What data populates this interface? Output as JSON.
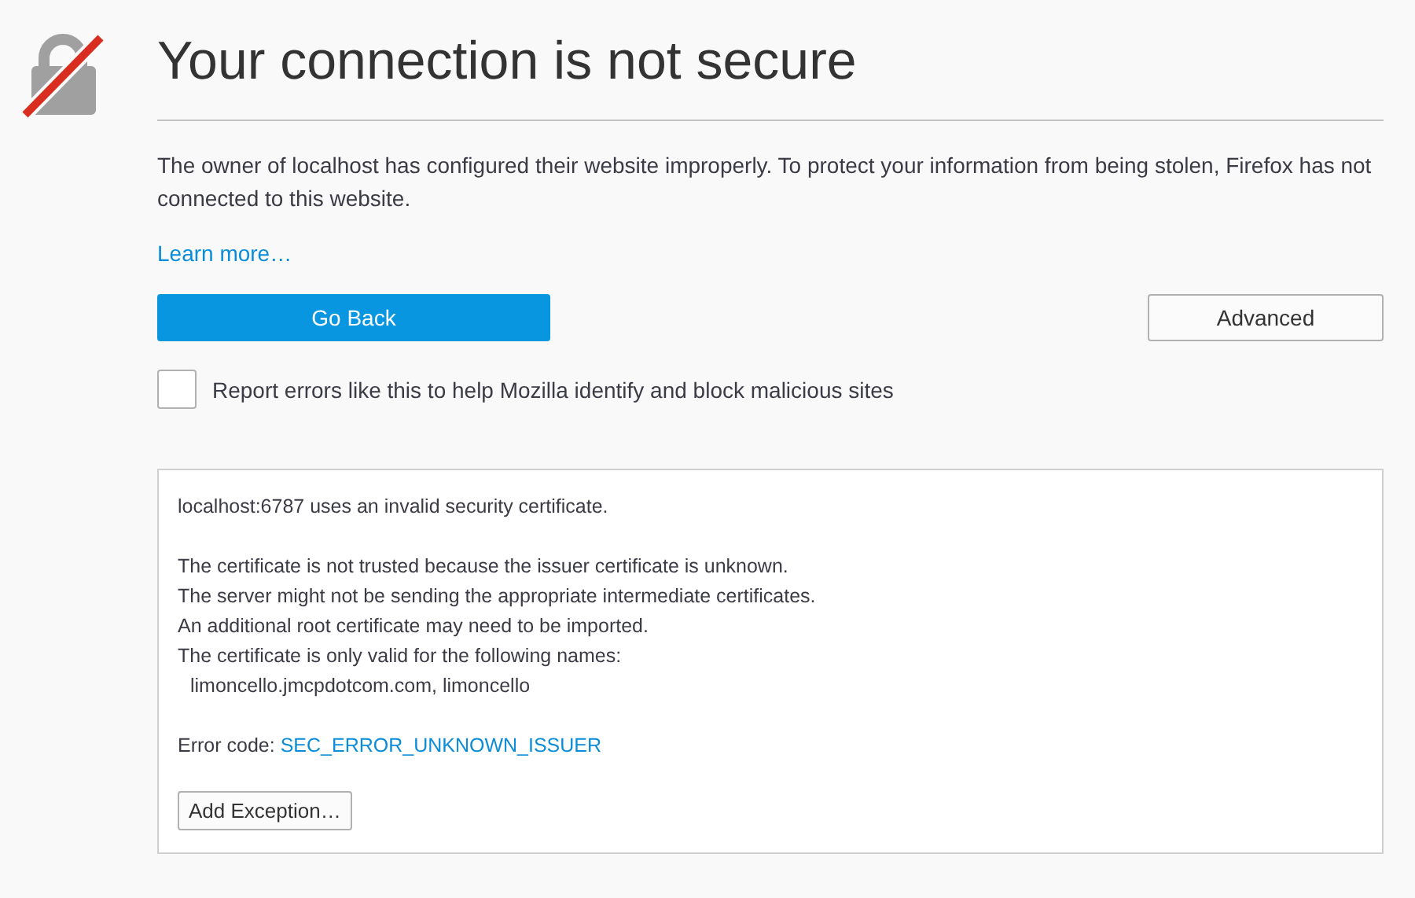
{
  "title": "Your connection is not secure",
  "description": "The owner of localhost has configured their website improperly. To protect your information from being stolen, Firefox has not connected to this website.",
  "learn_more": "Learn more…",
  "buttons": {
    "primary": "Go Back",
    "secondary": "Advanced"
  },
  "report_checkbox": {
    "label": "Report errors like this to help Mozilla identify and block malicious sites",
    "checked": false
  },
  "details": {
    "summary": "localhost:6787 uses an invalid security certificate.",
    "explanation": [
      "The certificate is not trusted because the issuer certificate is unknown.",
      "The server might not be sending the appropriate intermediate certificates.",
      "An additional root certificate may need to be imported.",
      "The certificate is only valid for the following names:"
    ],
    "valid_names": "limoncello.jmcpdotcom.com, limoncello",
    "error_code_label": "Error code:",
    "error_code": "SEC_ERROR_UNKNOWN_ISSUER",
    "button": "Add Exception…"
  }
}
